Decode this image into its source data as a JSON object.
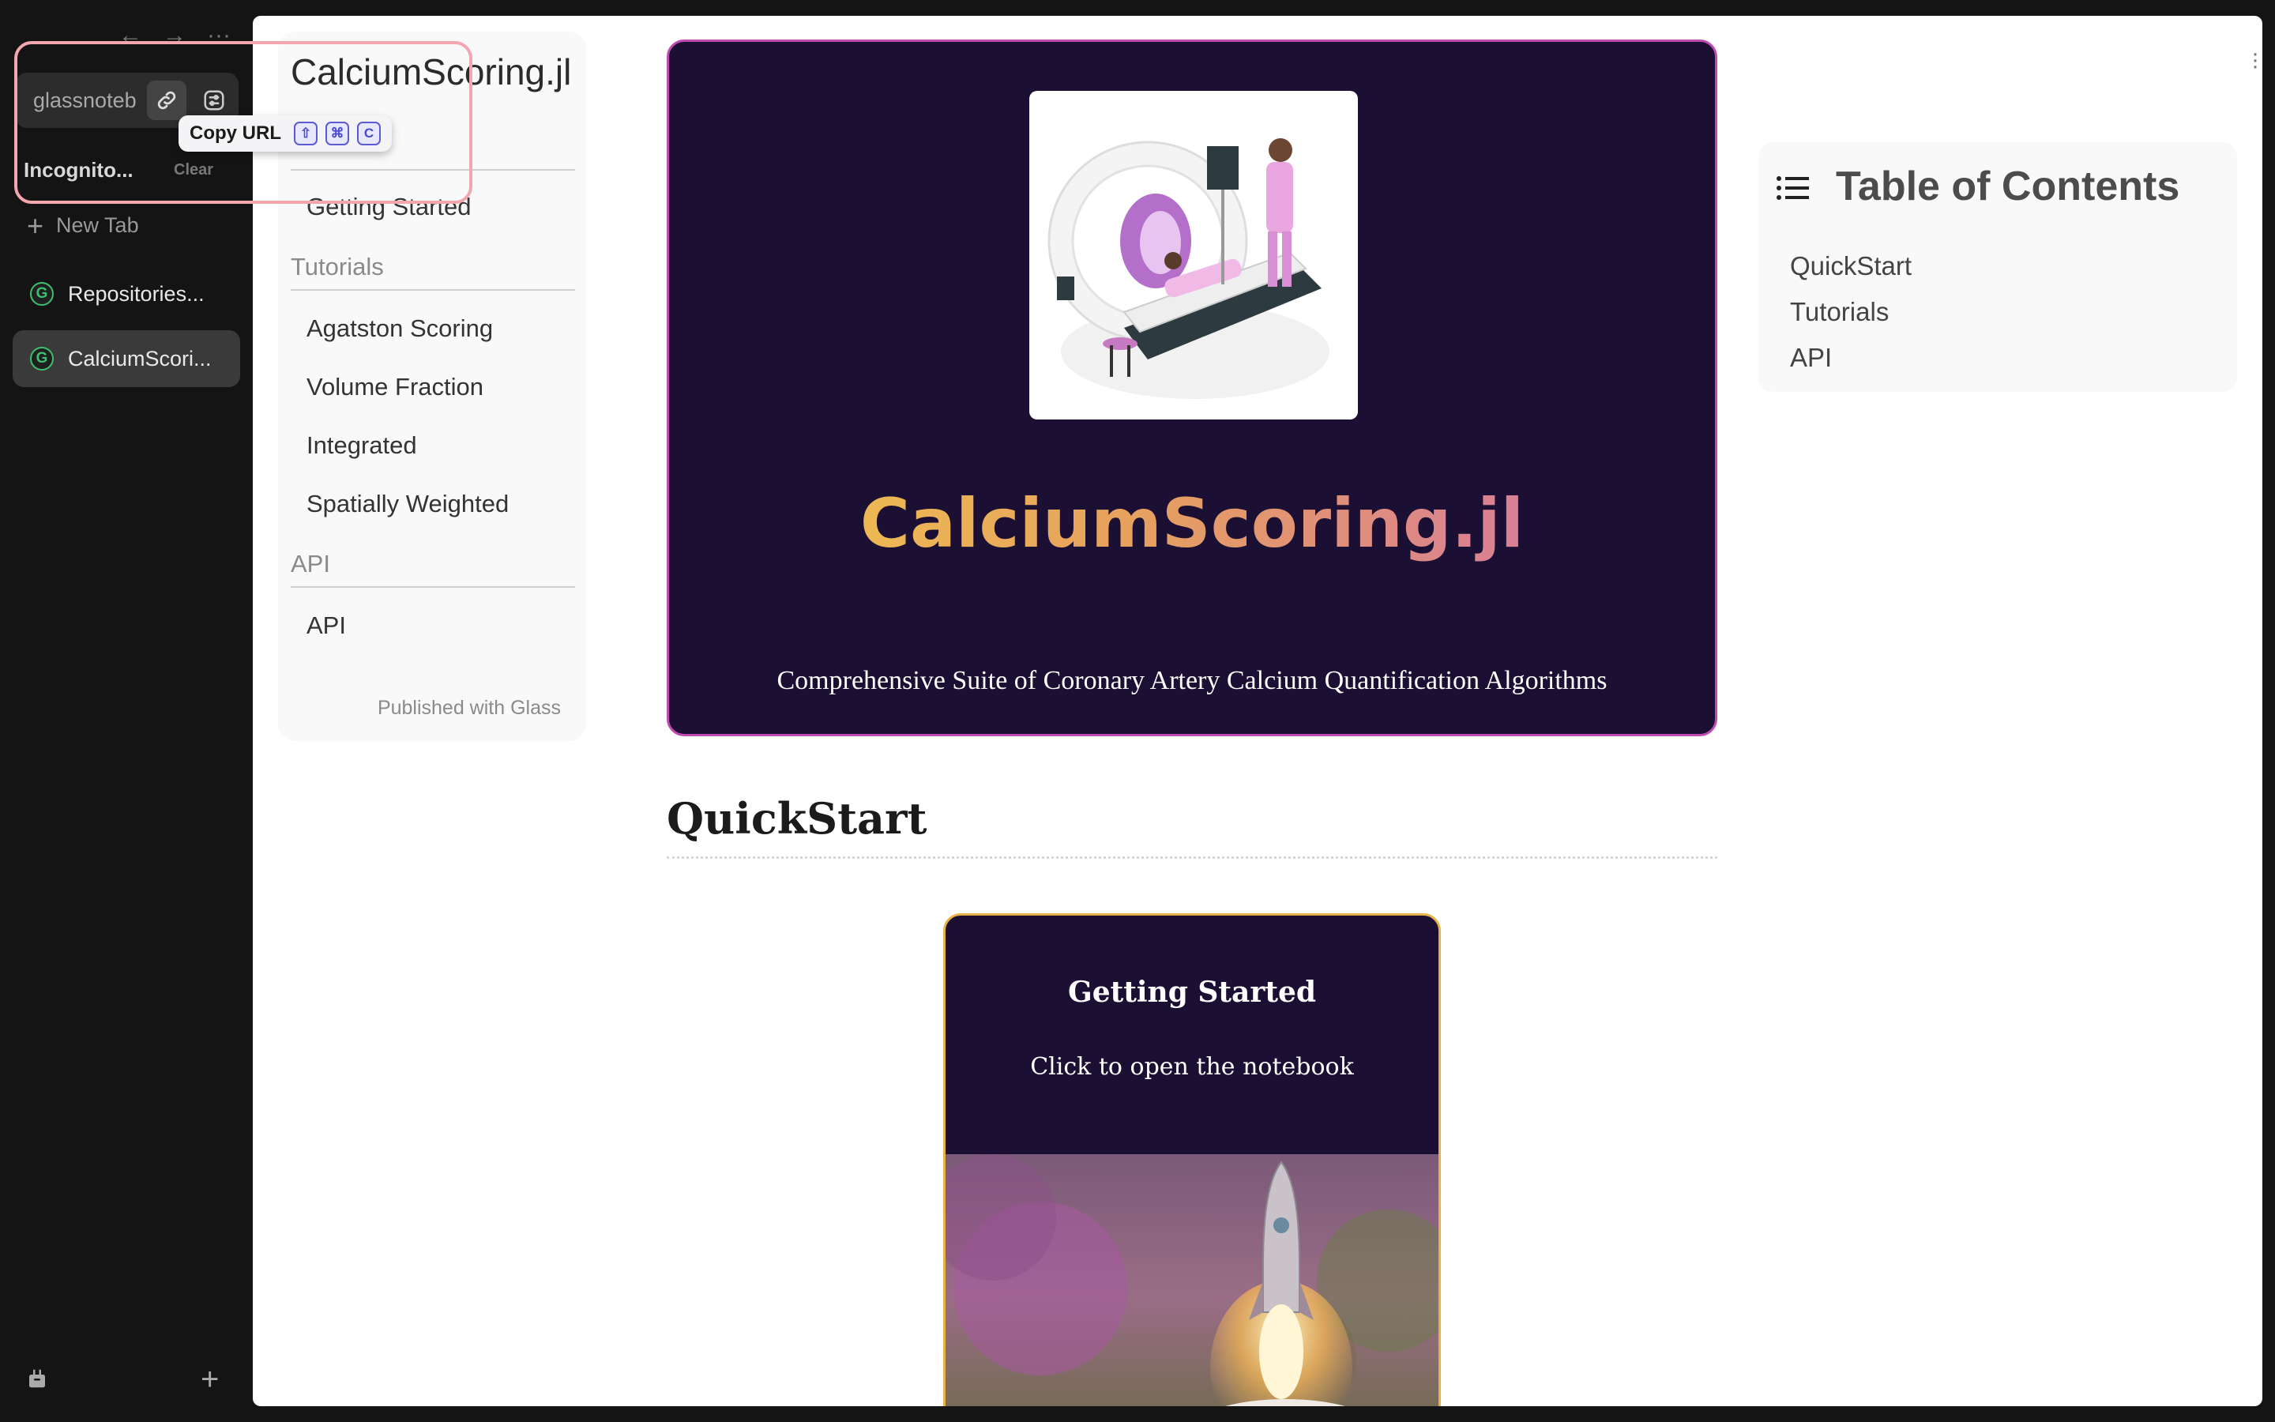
{
  "browser": {
    "url_text": "glassnoteb",
    "profile": "Incognito...",
    "clear_label": "Clear",
    "new_tab_label": "New Tab",
    "tabs": [
      {
        "label": "Repositories..."
      },
      {
        "label": "CalciumScori..."
      }
    ],
    "tooltip": {
      "label": "Copy URL",
      "keys": [
        "⇧",
        "⌘",
        "C"
      ]
    }
  },
  "doc_nav": {
    "title": "CalciumScoring.jl",
    "items_top": [
      "Getting Started"
    ],
    "sections": [
      {
        "title": "Tutorials",
        "items": [
          "Agatston Scoring",
          "Volume Fraction",
          "Integrated",
          "Spatially Weighted"
        ]
      },
      {
        "title": "API",
        "items": [
          "API"
        ]
      }
    ],
    "published": "Published with Glass"
  },
  "hero": {
    "title": "CalciumScoring.jl",
    "subtitle": "Comprehensive Suite of Coronary Artery Calcium Quantification Algorithms"
  },
  "quickstart": {
    "heading": "QuickStart",
    "card": {
      "title": "Getting Started",
      "subtitle": "Click to open the notebook"
    }
  },
  "toc": {
    "title": "Table of Contents",
    "items": [
      "QuickStart",
      "Tutorials",
      "API"
    ]
  }
}
